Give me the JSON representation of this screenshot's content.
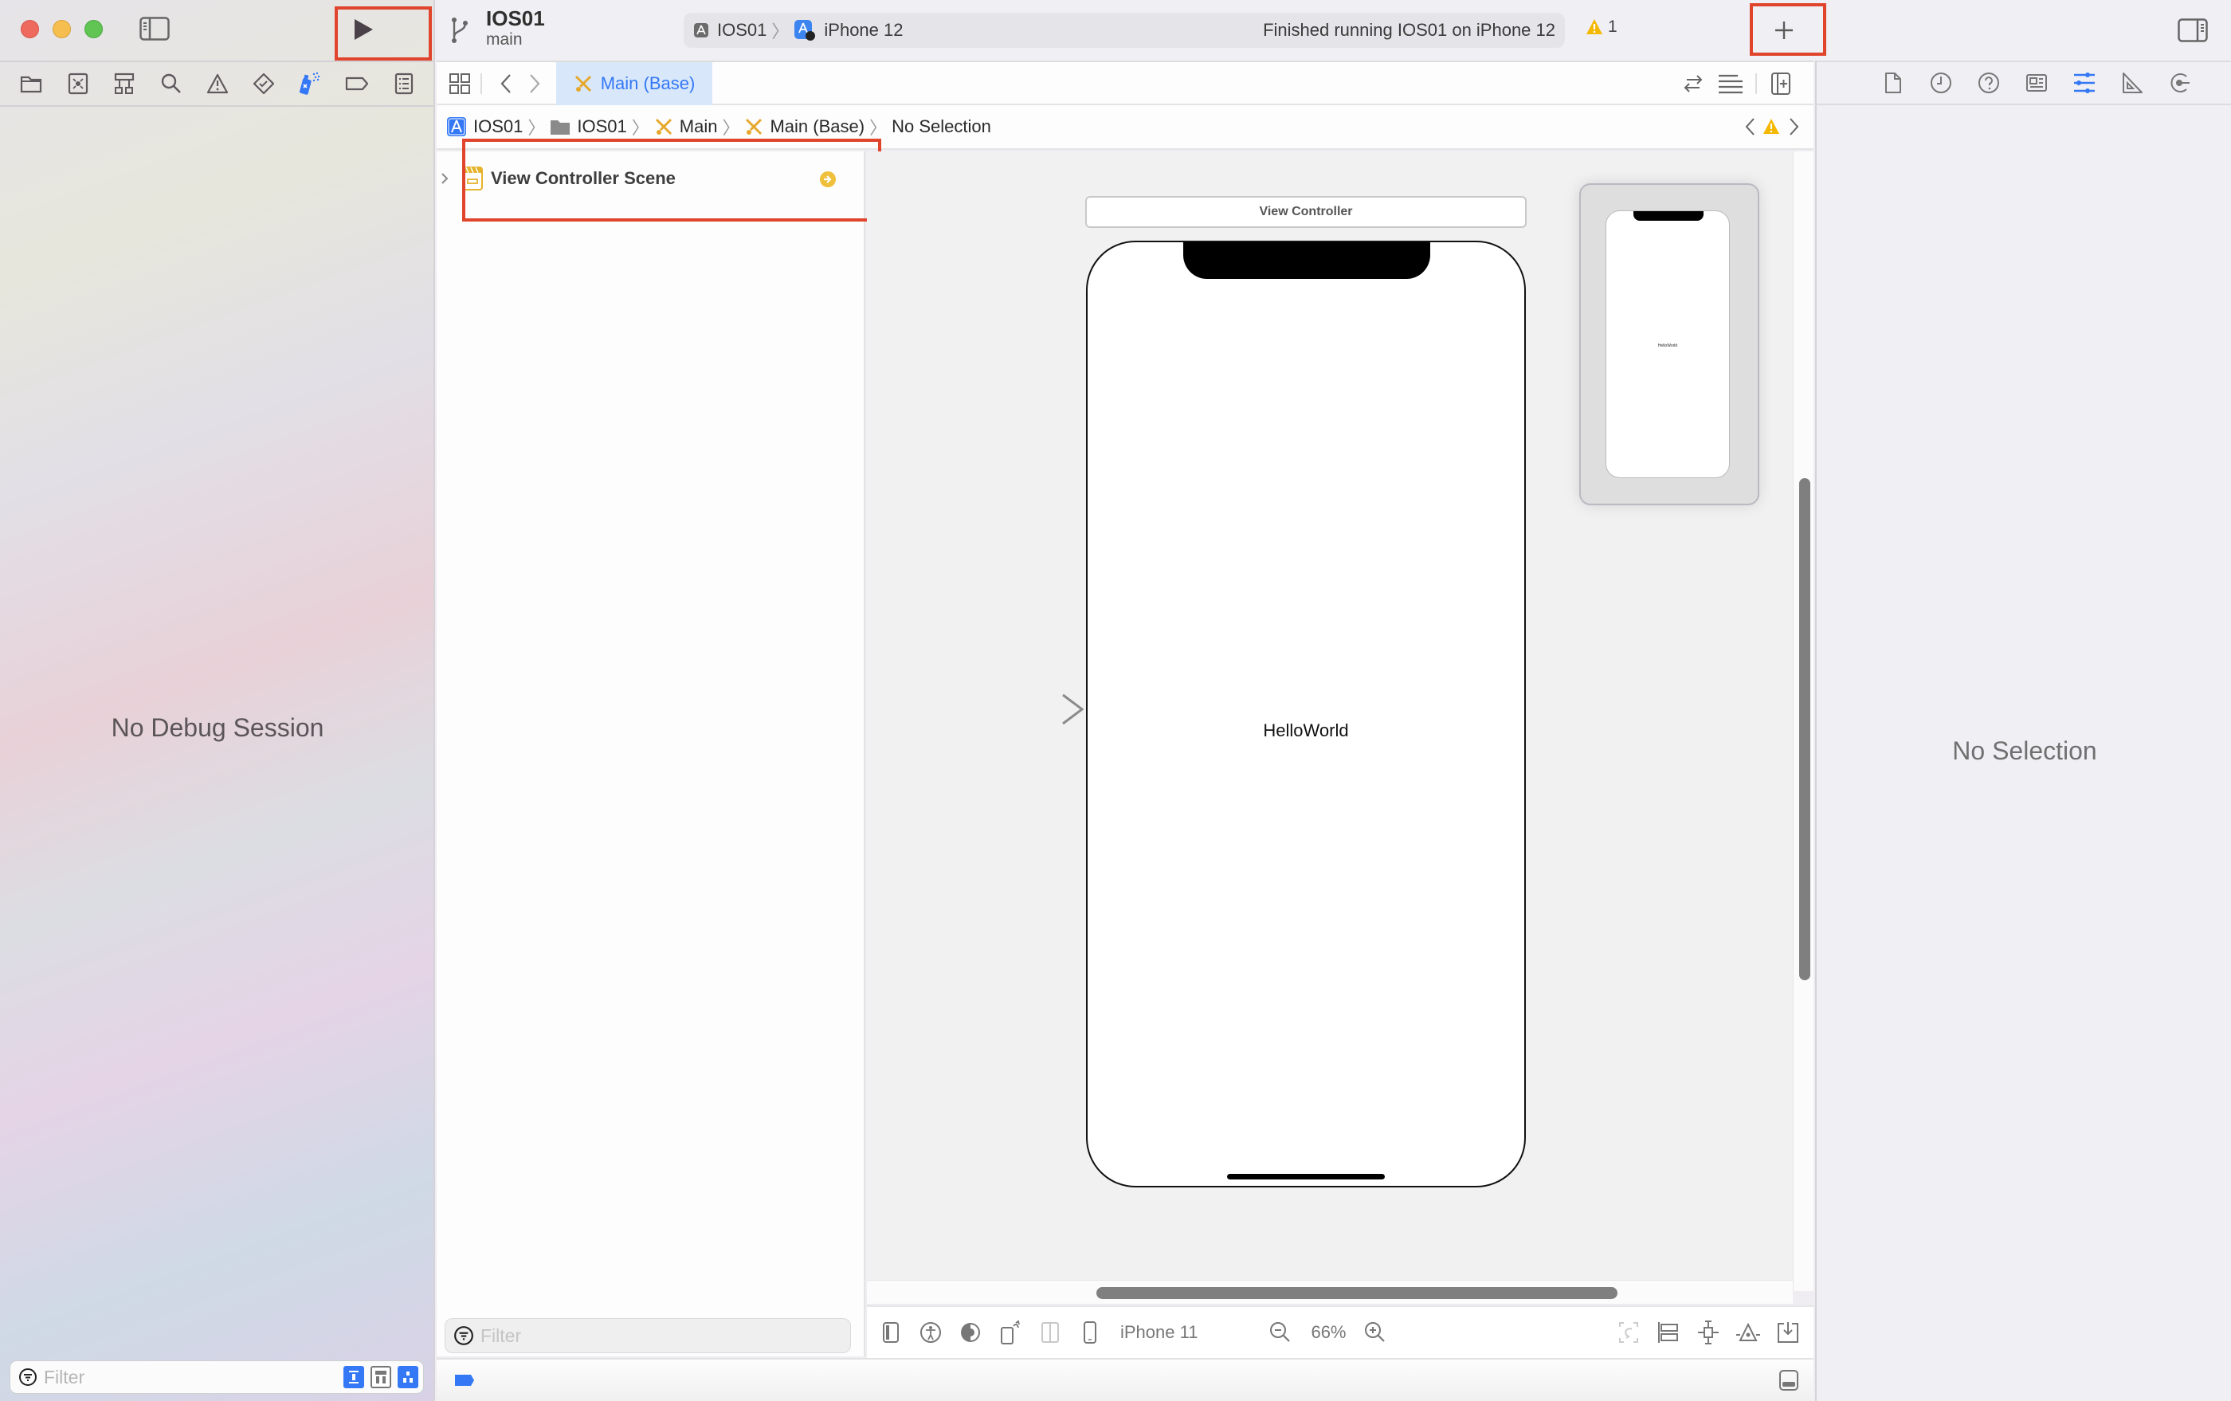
{
  "window": {
    "project_name": "IOS01",
    "branch": "main"
  },
  "toolbar": {
    "run_button_label": "Run",
    "scheme": "IOS01",
    "destination": "iPhone 12",
    "status_text": "Finished running IOS01 on iPhone 12",
    "warning_count": "1",
    "library_button_label": "+"
  },
  "navigator": {
    "icons": [
      "folder-icon",
      "source-control-icon",
      "symbol-hierarchy-icon",
      "find-icon",
      "issue-warning-icon",
      "test-diamond-icon",
      "debug-spray-icon",
      "breakpoint-tag-icon",
      "report-list-icon"
    ],
    "selected_icon": "debug-spray-icon",
    "empty_message": "No Debug Session",
    "filter_placeholder": "Filter"
  },
  "editor": {
    "tab_label": "Main (Base)",
    "breadcrumb": [
      "IOS01",
      "IOS01",
      "Main",
      "Main (Base)",
      "No Selection"
    ],
    "outline": {
      "scene_label": "View Controller Scene",
      "filter_placeholder": "Filter"
    },
    "canvas": {
      "view_controller_title": "View Controller",
      "label_text": "HelloWorld",
      "minimap_label_text": "HelloWorld"
    },
    "bottom_bar": {
      "device": "iPhone 11",
      "zoom": "66%"
    }
  },
  "inspector": {
    "tabs": [
      "file-inspector-icon",
      "history-icon",
      "quick-help-icon",
      "identity-icon",
      "attributes-icon",
      "size-icon",
      "connections-icon"
    ],
    "selected_tab": "attributes-icon",
    "empty_message": "No Selection"
  },
  "colors": {
    "accent": "#3478f6",
    "warning": "#f5b800",
    "highlight_box": "#e0442c",
    "storyboard_icon": "#e6a82c"
  }
}
